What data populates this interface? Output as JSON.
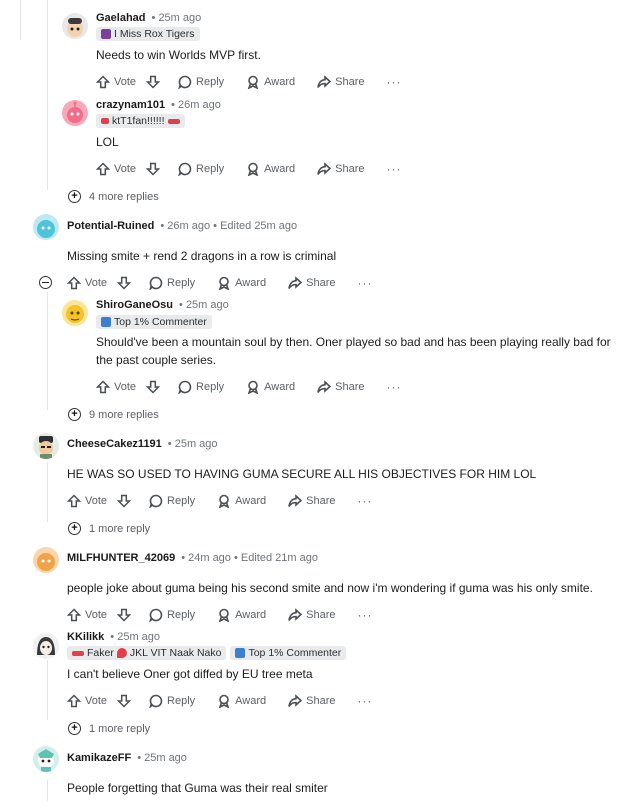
{
  "labels": {
    "vote": "Vote",
    "reply": "Reply",
    "award": "Award",
    "share": "Share",
    "more_dots": "···"
  },
  "comments": [
    {
      "author": "Gaelahad",
      "meta": "• 25m ago",
      "flairs": [
        {
          "text": "I Miss Rox Tigers",
          "color": "#7b3fa0"
        }
      ],
      "body": "Needs to win Worlds MVP first.",
      "avatar_color": "#d9d9d9"
    },
    {
      "author": "crazynam101",
      "meta": "• 26m ago",
      "flairs": [
        {
          "text": "ktT1fan!!!!!!",
          "color": "#e0414b"
        }
      ],
      "body": "LOL",
      "avatar_color": "#f26d8a"
    },
    {
      "author": "Potential-Ruined",
      "meta": "• 26m ago • Edited 25m ago",
      "flairs": [],
      "body": "Missing smite + rend 2 dragons in a row is criminal",
      "avatar_color": "#4fc3d9"
    },
    {
      "author": "ShiroGaneOsu",
      "meta": "• 25m ago",
      "flairs": [
        {
          "text": "Top 1% Commenter",
          "color": "#3b7fd1"
        }
      ],
      "body_line1": "Should've been a mountain soul by then. Oner played so bad and has been playing really bad for",
      "body_line2": "the past couple series.",
      "avatar_color": "#f2c42a"
    },
    {
      "author": "CheeseCakez1191",
      "meta": "• 25m ago",
      "flairs": [],
      "body": "HE WAS SO USED TO HAVING GUMA SECURE ALL HIS OBJECTIVES FOR HIM LOL",
      "avatar_color": "#6b8f6a"
    },
    {
      "author": "MILFHUNTER_42069",
      "meta": "• 24m ago • Edited 21m ago",
      "flairs": [],
      "body": "people joke about guma being his second smite and now i'm wondering if guma was his only smite.",
      "avatar_color": "#f0a34a"
    },
    {
      "author": "KKilikk",
      "meta": "• 25m ago",
      "flairs": [
        {
          "text": "Faker",
          "color": "#e0414b"
        },
        {
          "text": "JKL VIT Naak Nako",
          "color": "#e0414b"
        },
        {
          "text": "Top 1% Commenter",
          "color": "#3b7fd1"
        }
      ],
      "body": "I can't believe Oner got diffed by EU tree meta",
      "avatar_color": "#cfcfcf"
    },
    {
      "author": "KamikazeFF",
      "meta": "• 25m ago",
      "flairs": [],
      "body": "People forgetting that Guma was their real smiter",
      "avatar_color": "#5fc2b4"
    }
  ],
  "more_replies": {
    "a": "4 more replies",
    "b": "9 more replies",
    "c": "1 more reply",
    "d": "1 more reply"
  }
}
